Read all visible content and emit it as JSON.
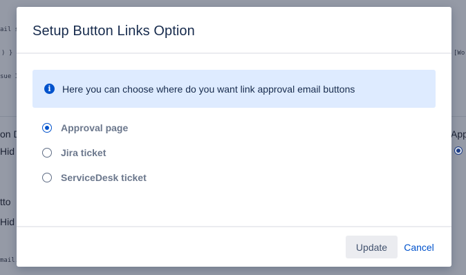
{
  "modal": {
    "title": "Setup Button Links Option",
    "info_text": "Here you can choose where do you want link approval email buttons",
    "info_icon": "info-icon",
    "options": [
      {
        "label": "Approval page",
        "checked": true
      },
      {
        "label": "Jira ticket",
        "checked": false
      },
      {
        "label": "ServiceDesk ticket",
        "checked": false
      }
    ],
    "update_label": "Update",
    "cancel_label": "Cancel"
  },
  "background": {
    "frag_1": "ail su",
    "frag_2": ") }",
    "frag_3": "sue I",
    "frag_4": "[Wo",
    "frag_5": "on D",
    "frag_6": "Hid",
    "frag_7": "App",
    "frag_8": "tto",
    "frag_9": "Hid",
    "frag_10": "mail."
  },
  "colors": {
    "accent": "#0052cc",
    "banner": "#deebff",
    "overlay": "#959aa6"
  }
}
